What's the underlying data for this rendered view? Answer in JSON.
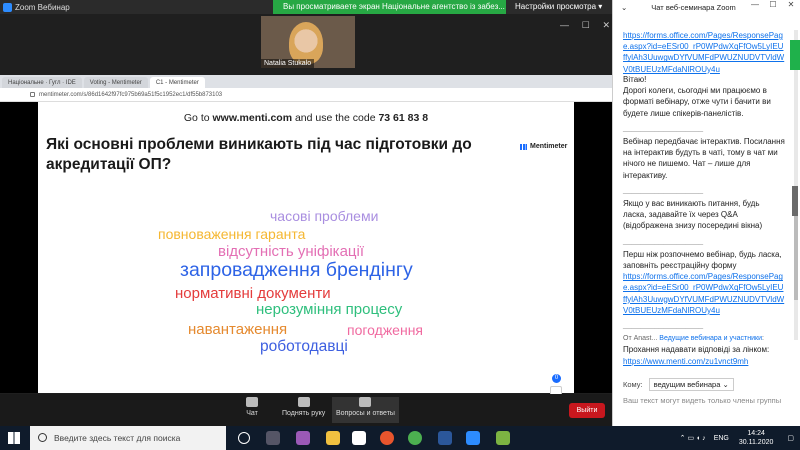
{
  "zoom": {
    "window_title": "Zoom Вебинар",
    "share_banner": "Вы просматриваете экран Національне агентство із забез...",
    "view_settings": "Настройки просмотра",
    "participant_name": "Natalia Stukalo",
    "toolbar": {
      "chat": "Чат",
      "raise_hand": "Поднять руку",
      "qa": "Вопросы и ответы",
      "leave": "Выйти"
    }
  },
  "browser": {
    "tabs": [
      "Національне · Гугл · IDE",
      "Voting - Mentimeter",
      "C1 - Mentimeter"
    ],
    "url": "mentimeter.com/s/86d1642f97fc975b69a51f5c1952ec1/df55b873103"
  },
  "slide": {
    "code_prefix": "Go to ",
    "site": "www.menti.com",
    "code_mid": " and use the code ",
    "code": "73 61 83 8",
    "question": "Які основні проблеми виникають під час підготовки до акредитації ОП?",
    "logo": "Mentimeter",
    "avatar_count": "0",
    "words": [
      {
        "text": "часові проблеми",
        "color": "#a98ee0"
      },
      {
        "text": "повноваження гаранта",
        "color": "#f5b731"
      },
      {
        "text": "відсутність уніфікації",
        "color": "#e36fb4"
      },
      {
        "text": "запровадження брендінгу",
        "color": "#2d63e6"
      },
      {
        "text": "нормативні документи",
        "color": "#e43c3c"
      },
      {
        "text": "нерозуміння процесу",
        "color": "#2fbf7d"
      },
      {
        "text": "навантаження",
        "color": "#e58a2f"
      },
      {
        "text": "погодження",
        "color": "#f06aa0"
      },
      {
        "text": "роботодавці",
        "color": "#3d5fe0"
      }
    ]
  },
  "chat": {
    "title": "Чат веб-семинара Zoom",
    "link1": "https://forms.office.com/Pages/ResponsePage.aspx?id=eESr00_rP0WPdwXqFfOw5LyIEUffylAh3UuwgwDYfVUMFdPWUZNUDVTVldWV0tBUEUzMFdaNlROUy4u",
    "greeting": "Вітаю!",
    "msg1": "Дорогі колеги, сьогодні ми працюємо в форматі вебінару, отже чути і бачити ви будете лише спікерів-панелістів.",
    "sep": "__________________",
    "msg2": "Вебінар передбачає інтерактив. Посилання на інтерактив будуть в чаті, тому в чат ми нічого не пишемо. Чат – лише для інтерактиву.",
    "msg3": "Якщо у вас виникають питання, будь ласка, задавайте їх через Q&A (відображена знизу посередині вікна)",
    "msg4": "Перш ніж розпочнемо вебінар, будь ласка, заповніть реєстраційну форму",
    "link2": "https://forms.office.com/Pages/ResponsePage.aspx?id=eESr00_rP0WPdwXqFfOw5LyIEUffylAh3UuwgwDYfVUMFdPWUZNUDVTVldWV0tBUEUzMFdaNlROUy4u",
    "meta_from": "От Anast... ",
    "meta_to": "Ведущие вебинара и участники",
    "meta_suffix": ":",
    "msg5": "Прохання надавати відповіді за лінком:",
    "link3": "https://www.menti.com/zu1vnct9mh",
    "recipient_label": "Кому:",
    "recipient_value": "ведущим вебинара",
    "input_placeholder": "Ваш текст могут видеть только члены группы"
  },
  "taskbar": {
    "search": "Введите здесь текст для поиска",
    "lang": "ENG",
    "time": "14:24",
    "date": "30.11.2020"
  }
}
